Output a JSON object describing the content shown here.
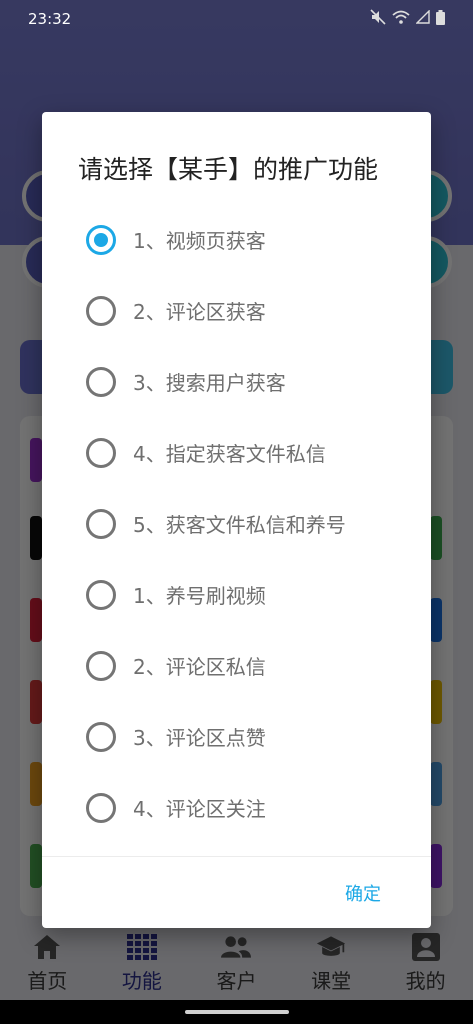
{
  "status_bar": {
    "time": "23:32"
  },
  "dialog": {
    "title": "请选择【某手】的推广功能",
    "selected_index": 0,
    "options": [
      {
        "label": "1、视频页获客",
        "checked": true
      },
      {
        "label": "2、评论区获客",
        "checked": false
      },
      {
        "label": "3、搜索用户获客",
        "checked": false
      },
      {
        "label": "4、指定获客文件私信",
        "checked": false
      },
      {
        "label": "5、获客文件私信和养号",
        "checked": false
      },
      {
        "label": "1、养号刷视频",
        "checked": false
      },
      {
        "label": "2、评论区私信",
        "checked": false
      },
      {
        "label": "3、评论区点赞",
        "checked": false
      },
      {
        "label": "4、评论区关注",
        "checked": false
      }
    ],
    "confirm_label": "确定"
  },
  "bottom_nav": {
    "active_index": 1,
    "items": [
      {
        "label": "首页",
        "icon": "home-icon"
      },
      {
        "label": "功能",
        "icon": "grid-icon"
      },
      {
        "label": "客户",
        "icon": "people-icon"
      },
      {
        "label": "课堂",
        "icon": "graduation-cap-icon"
      },
      {
        "label": "我的",
        "icon": "profile-icon"
      }
    ]
  },
  "colors": {
    "accent": "#1ca8e6",
    "header": "#7b7fd6",
    "nav_active": "#2d2f8f"
  }
}
